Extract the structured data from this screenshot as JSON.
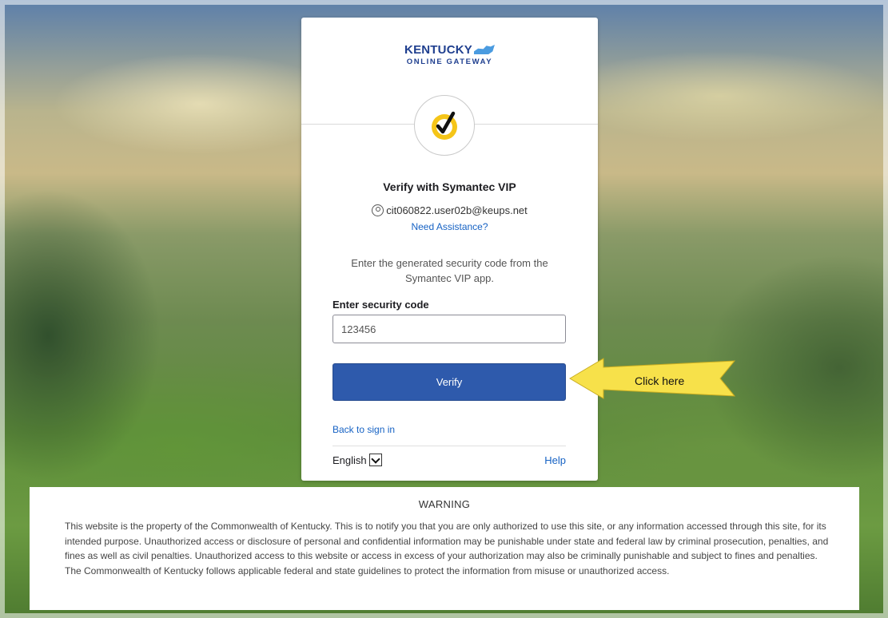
{
  "logo": {
    "line1": "KENTUCKY",
    "line2": "ONLINE GATEWAY"
  },
  "verify": {
    "title": "Verify with Symantec VIP",
    "username": "cit060822.user02b@keups.net",
    "need_assistance": "Need Assistance?",
    "instructions": "Enter the generated security code from the Symantec VIP app.",
    "code_label": "Enter security code",
    "code_value": "123456",
    "verify_button": "Verify",
    "back_link": "Back to sign in",
    "language": "English",
    "help_link": "Help"
  },
  "callout": {
    "text": "Click here",
    "color": "#f7e14a"
  },
  "warning": {
    "title": "WARNING",
    "body": "This website is the property of the Commonwealth of Kentucky. This is to notify you that you are only authorized to use this site, or any information accessed through this site, for its intended purpose. Unauthorized access or disclosure of personal and confidential information may be punishable under state and federal law by criminal prosecution, penalties, and fines as well as civil penalties. Unauthorized access to this website or access in excess of your authorization may also be criminally punishable and subject to fines and penalties. The Commonwealth of Kentucky follows applicable federal and state guidelines to protect the information from misuse or unauthorized access."
  },
  "colors": {
    "primary_button": "#2e5aac",
    "link": "#1662c4",
    "brand": "#1f3f8f",
    "symantec_yellow": "#f5c518"
  }
}
